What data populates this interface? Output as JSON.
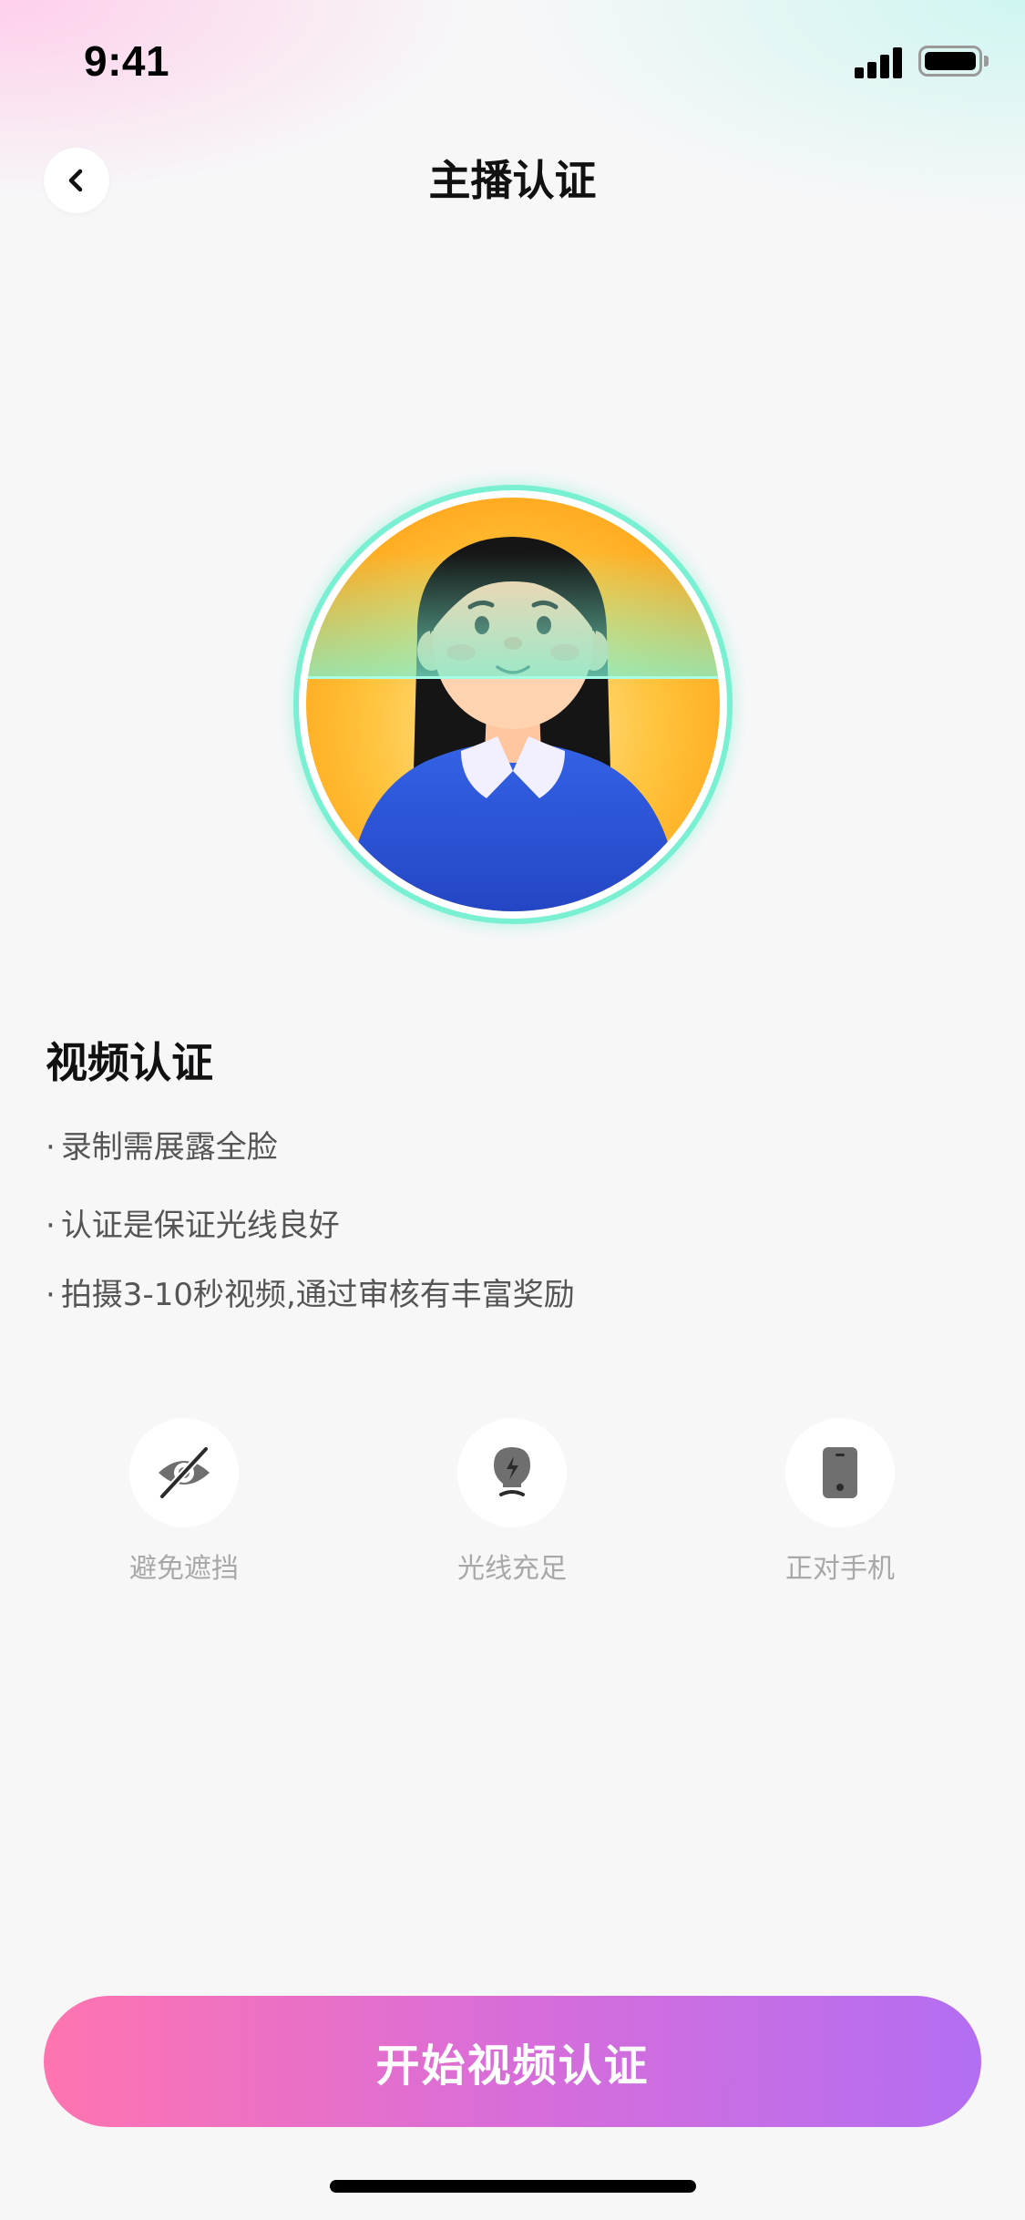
{
  "status_bar": {
    "time": "9:41"
  },
  "header": {
    "title": "主播认证"
  },
  "section": {
    "title": "视频认证",
    "tips": [
      "录制需展露全脸",
      "认证是保证光线良好",
      "拍摄3-10秒视频,通过审核有丰富奖励"
    ],
    "bullet": "·"
  },
  "features": [
    {
      "label": "避免遮挡",
      "icon": "eye-slash-icon"
    },
    {
      "label": "光线充足",
      "icon": "lightbulb-icon"
    },
    {
      "label": "正对手机",
      "icon": "phone-icon"
    }
  ],
  "cta": {
    "label": "开始视频认证"
  },
  "colors": {
    "ring": "#79f0d2",
    "gradient_start": "#ff74b0",
    "gradient_end": "#b36ef2",
    "avatar_bg": "#ffb22a",
    "sweater": "#2f56d8"
  }
}
